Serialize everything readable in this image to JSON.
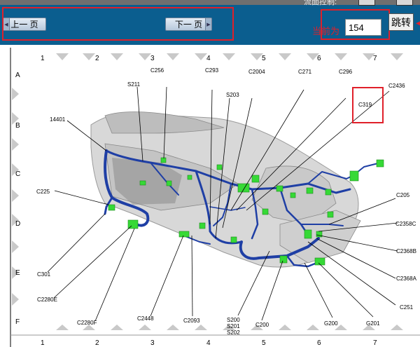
{
  "toolbar": {
    "prev_label": "上一 页",
    "next_label": "下一 页",
    "current_page_label": "当前为",
    "current_page_value": "154",
    "go_label": "跳转",
    "top_title_fragment": "流面控制:"
  },
  "colors": {
    "toolbar_bg": "#0b5e8f",
    "highlight": "#e0202a",
    "harness": "#1f3fa5",
    "connector": "#36d936"
  },
  "grid": {
    "columns": [
      "1",
      "2",
      "3",
      "4",
      "5",
      "6",
      "7"
    ],
    "rows": [
      "A",
      "B",
      "C",
      "D",
      "E",
      "F"
    ]
  },
  "connectors": {
    "c256": "C256",
    "c293": "C293",
    "c2004": "C2004",
    "c271": "C271",
    "c296": "C296",
    "s211": "S211",
    "s203": "S203",
    "c2436": "C2436",
    "c319": "C319",
    "n14401": "14401",
    "c225": "C225",
    "c205": "C205",
    "c2358c": "C2358C",
    "c2368b": "C2368B",
    "c2368a": "C2368A",
    "c301": "C301",
    "c2280e": "C2280E",
    "c251": "C251",
    "c2280f": "C2280F",
    "c2448": "C2448",
    "c2093": "C2093",
    "s200": "S200",
    "s201": "S201",
    "s202": "S202",
    "c200": "C200",
    "g200": "G200",
    "g201": "G201"
  }
}
